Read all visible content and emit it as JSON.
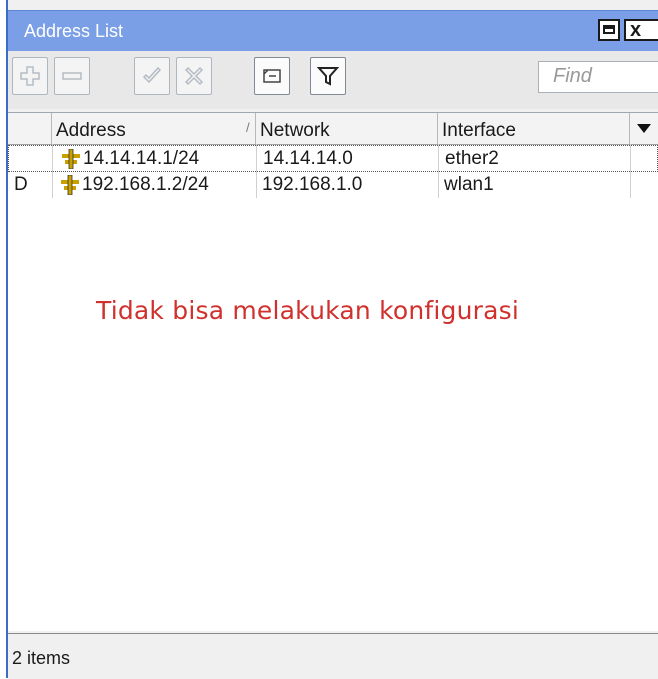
{
  "window": {
    "title": "Address List",
    "close_label": "x"
  },
  "toolbar": {
    "buttons": [
      {
        "icon": "plus-icon",
        "glyph": "+"
      },
      {
        "icon": "minus-icon",
        "glyph": "−"
      },
      {
        "icon": "check-icon",
        "glyph": "✓"
      },
      {
        "icon": "x-icon",
        "glyph": "✕"
      },
      {
        "icon": "comment-icon",
        "glyph": "▭"
      },
      {
        "icon": "filter-icon",
        "glyph": "▼"
      }
    ],
    "find_placeholder": "Find"
  },
  "table": {
    "columns": [
      "Address",
      "Network",
      "Interface"
    ],
    "sort_indicator": "/",
    "rows": [
      {
        "flag": "",
        "address": "14.14.14.1/24",
        "network": "14.14.14.0",
        "interface": "ether2"
      },
      {
        "flag": "D",
        "address": "192.168.1.2/24",
        "network": "192.168.1.0",
        "interface": "wlan1"
      }
    ]
  },
  "annotation": "Tidak bisa melakukan konfigurasi",
  "status": {
    "items_text": "2 items"
  },
  "colors": {
    "titlebar": "#7a9fe6",
    "annotation": "#d0312d",
    "address_icon": "#c8a000"
  }
}
